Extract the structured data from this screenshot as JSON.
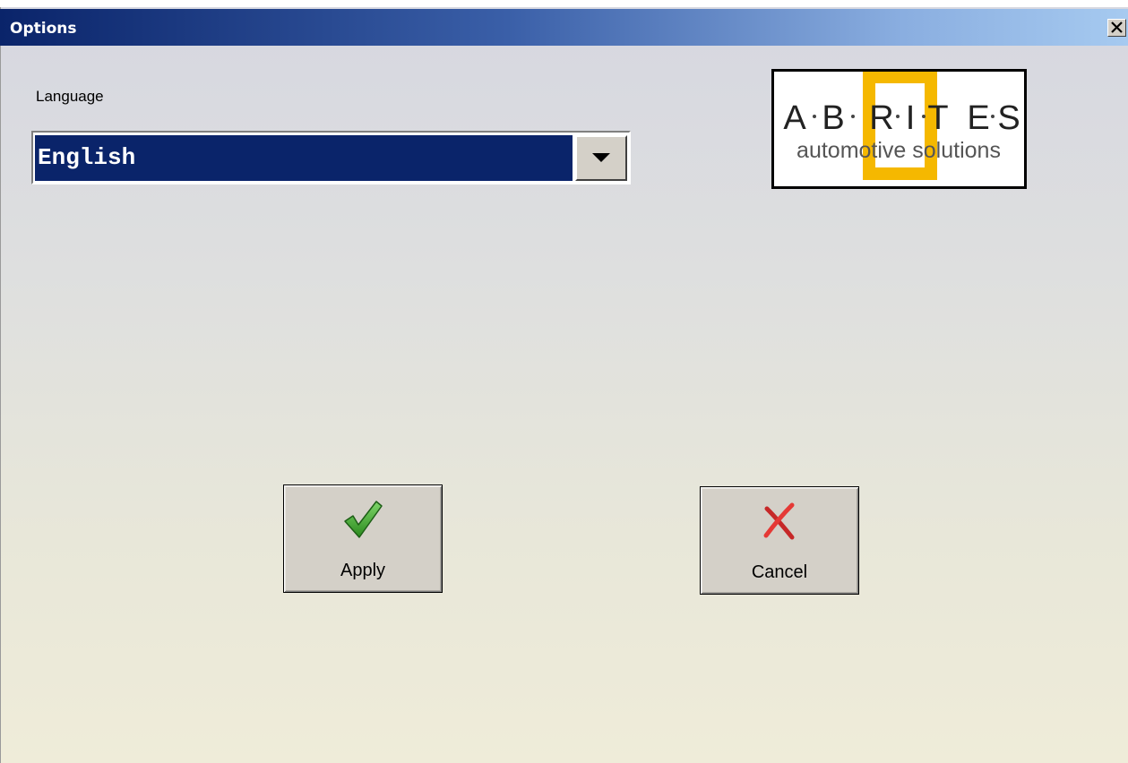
{
  "window": {
    "title": "Options",
    "close_icon": "close-icon"
  },
  "language": {
    "label": "Language",
    "selected": "English",
    "dropdown_icon": "chevron-down-icon"
  },
  "logo": {
    "letters": [
      "A",
      "B",
      "R",
      "I",
      "T",
      "E",
      "S"
    ],
    "tagline": "automotive solutions",
    "accent_color": "#f5b800"
  },
  "buttons": {
    "apply": {
      "label": "Apply",
      "icon": "checkmark-icon"
    },
    "cancel": {
      "label": "Cancel",
      "icon": "x-mark-icon"
    }
  },
  "colors": {
    "title_bar_start": "#0a246a",
    "title_bar_end": "#a6caf0",
    "selection_bg": "#0a246a",
    "button_face": "#d4d0c8"
  }
}
